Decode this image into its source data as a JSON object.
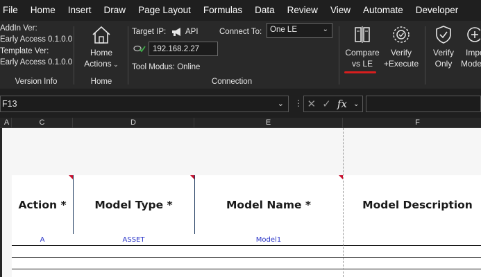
{
  "menu": {
    "tabs": [
      "File",
      "Home",
      "Insert",
      "Draw",
      "Page Layout",
      "Formulas",
      "Data",
      "Review",
      "View",
      "Automate",
      "Developer"
    ]
  },
  "ribbon": {
    "version_info": {
      "addin_label": "AddIn Ver:",
      "addin_value": "Early Access 0.1.0.0",
      "template_label": "Template Ver:",
      "template_value": "Early Access 0.1.0.0",
      "group_label": "Version Info"
    },
    "home": {
      "button_line1": "Home",
      "button_line2": "Actions",
      "group_label": "Home"
    },
    "connection": {
      "target_ip_label": "Target IP:",
      "api_label": "API",
      "connect_to_label": "Connect To:",
      "connect_to_value": "One LE",
      "ip_value": "192.168.2.27",
      "tool_modus": "Tool Modus: Online",
      "group_label": "Connection"
    },
    "actions": {
      "compare_line1": "Compare",
      "compare_line2": "vs LE",
      "verify_exec_line1": "Verify",
      "verify_exec_line2": "+Execute",
      "verify_only_line1": "Verify",
      "verify_only_line2": "Only",
      "import_line1": "Impo",
      "import_line2": "Mode"
    },
    "colors": {
      "accent_underline": "#d81e1e"
    }
  },
  "formula_bar": {
    "name_box": "F13",
    "formula": ""
  },
  "sheet": {
    "columns": [
      "A",
      "C",
      "D",
      "E",
      "F"
    ],
    "headers": [
      "Action *",
      "Model Type *",
      "Model Name *",
      "Model Description"
    ],
    "rows": [
      [
        "A",
        "ASSET",
        "Model1",
        ""
      ]
    ],
    "colors": {
      "data_text": "#2a35c8",
      "required_marker": "#c8102e"
    }
  }
}
